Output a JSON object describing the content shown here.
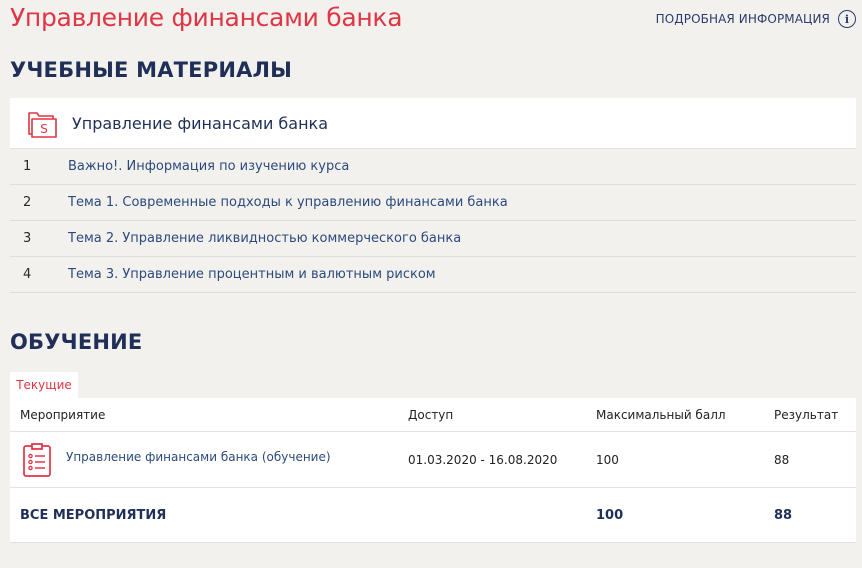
{
  "header": {
    "title": "Управление финансами банка",
    "more_info": "ПОДРОБНАЯ ИНФОРМАЦИЯ",
    "info_icon": "i"
  },
  "materials": {
    "section_title": "УЧЕБНЫЕ МАТЕРИАЛЫ",
    "course_name": "Управление финансами банка",
    "course_icon_letter": "S",
    "items": [
      {
        "num": "1",
        "label": "Важно!. Информация по изучению курса"
      },
      {
        "num": "2",
        "label": "Тема 1. Современные подходы к управлению финансами банка"
      },
      {
        "num": "3",
        "label": "Тема 2. Управление ликвидностью коммерческого банка"
      },
      {
        "num": "4",
        "label": "Тема 3. Управление процентным и валютным риском"
      }
    ]
  },
  "training": {
    "section_title": "ОБУЧЕНИЕ",
    "tab_current": "Текущие",
    "columns": {
      "event": "Мероприятие",
      "access": "Доступ",
      "max_score": "Максимальный балл",
      "result": "Результат"
    },
    "rows": [
      {
        "event": "Управление финансами банка (обучение)",
        "access": "01.03.2020 - 16.08.2020",
        "max_score": "100",
        "result": "88"
      }
    ],
    "total": {
      "label": "ВСЕ МЕРОПРИЯТИЯ",
      "max_score": "100",
      "result": "88"
    }
  },
  "colors": {
    "accent": "#e03545",
    "heading": "#1f2f57",
    "link": "#2d4a7c",
    "background": "#f2f1ee"
  },
  "icons": {
    "course": "folder-dollar-icon",
    "event": "clipboard-checklist-icon",
    "info": "info-circle-icon"
  }
}
